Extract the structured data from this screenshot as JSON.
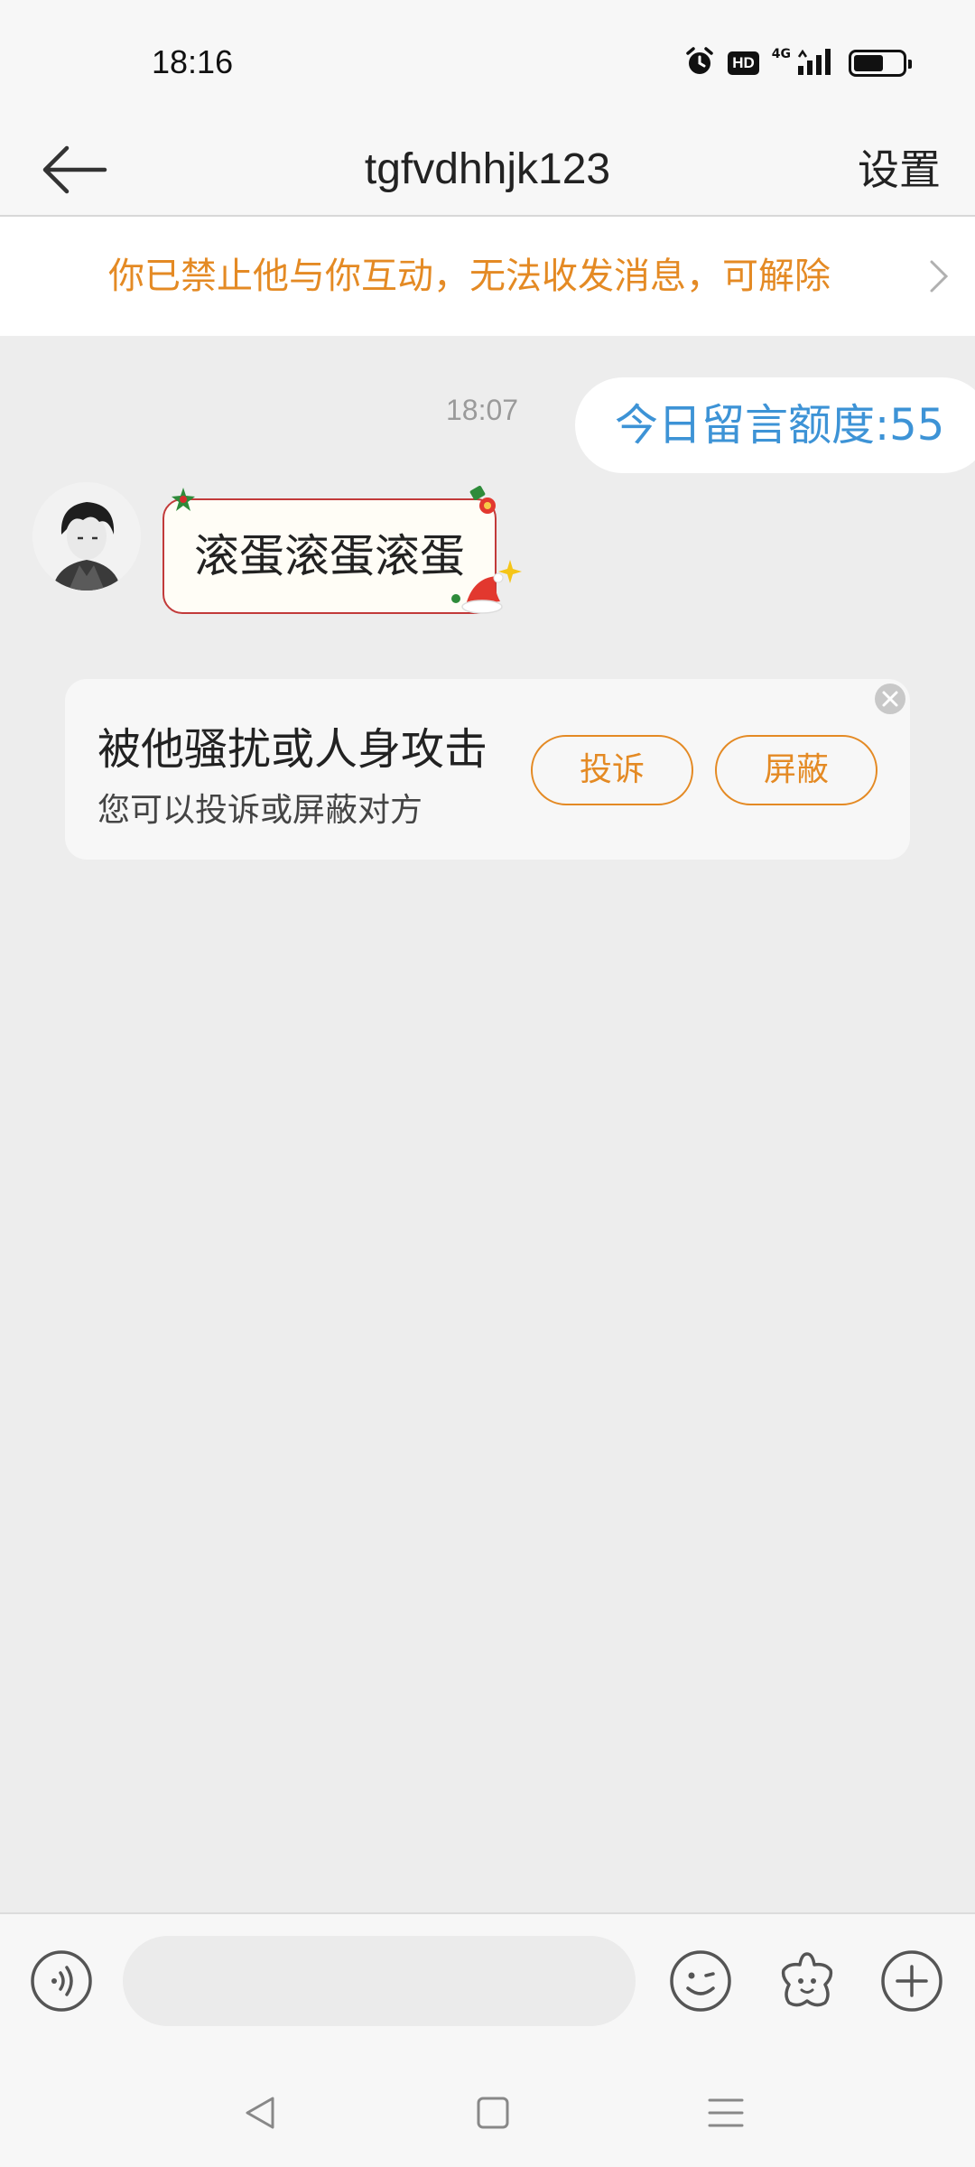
{
  "status_bar": {
    "time": "18:16",
    "hd_badge": "HD",
    "network_label": "4G",
    "icons": [
      "alarm-icon",
      "hd-icon",
      "signal-icon",
      "battery-icon"
    ]
  },
  "header": {
    "title": "tgfvdhhjk123",
    "settings_label": "设置",
    "back_icon": "back-arrow-icon"
  },
  "notice": {
    "text": "你已禁止他与你互动，无法收发消息，可解除",
    "icon": "chevron-right-icon"
  },
  "chat": {
    "timestamp": "18:07",
    "outgoing_message": "今日留言额度:55",
    "incoming_message": "滚蛋滚蛋滚蛋"
  },
  "report_card": {
    "title": "被他骚扰或人身攻击",
    "subtitle": "您可以投诉或屏蔽对方",
    "report_label": "投诉",
    "block_label": "屏蔽"
  },
  "input_bar": {
    "placeholder": "",
    "icons": [
      "voice-icon",
      "emoji-icon",
      "sticker-icon",
      "plus-icon"
    ]
  },
  "nav_bar": {
    "icons": [
      "nav-back-icon",
      "nav-home-icon",
      "nav-menu-icon"
    ]
  },
  "colors": {
    "accent_orange": "#e48a24",
    "outgoing_text_blue": "#3d93d6",
    "bubble_border_red": "#c23a3a",
    "chat_background": "#ededed"
  }
}
